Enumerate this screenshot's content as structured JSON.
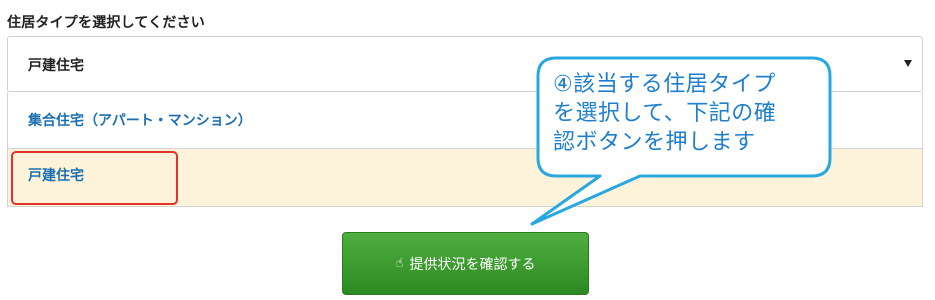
{
  "heading": "住居タイプを選択してください",
  "select": {
    "value": "戸建住宅"
  },
  "options": [
    {
      "label": "集合住宅（アパート・マンション）"
    },
    {
      "label": "戸建住宅"
    }
  ],
  "confirm_button": {
    "label": "提供状況を確認する",
    "icon": "pointing-hand-icon"
  },
  "callout": {
    "line1": "④該当する住居タイプ",
    "line2": "を選択して、下記の確",
    "line3": "認ボタンを押します"
  },
  "colors": {
    "accent_blue": "#1b6fb0",
    "button_green": "#3a9a2e",
    "highlight_red": "#e0322f",
    "selected_bg": "#fdf3da",
    "callout_border": "#29a8e0"
  }
}
